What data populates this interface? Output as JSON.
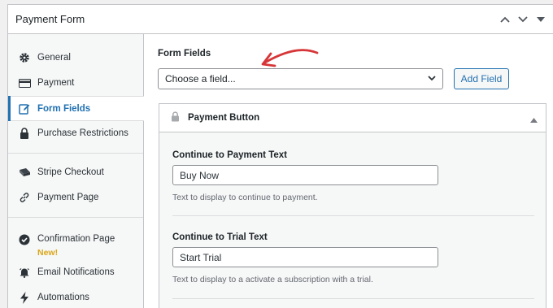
{
  "panel": {
    "title": "Payment Form"
  },
  "sidebar": {
    "tabs": [
      {
        "label": "General",
        "icon": "gear-icon"
      },
      {
        "label": "Payment",
        "icon": "credit-card-icon"
      },
      {
        "label": "Form Fields",
        "icon": "edit-icon"
      },
      {
        "label": "Purchase Restrictions",
        "icon": "lock-icon"
      },
      {
        "label": "Stripe Checkout",
        "icon": "stripe-icon"
      },
      {
        "label": "Payment Page",
        "icon": "link-icon"
      },
      {
        "label": "Confirmation Page",
        "badge": "New!",
        "icon": "check-circle-icon"
      },
      {
        "label": "Email Notifications",
        "icon": "bell-icon"
      },
      {
        "label": "Automations",
        "icon": "bolt-icon"
      }
    ]
  },
  "main": {
    "form_fields_label": "Form Fields",
    "select_value": "Choose a field...",
    "add_field_label": "Add Field",
    "field": {
      "title": "Payment Button",
      "continue_label": "Continue to Payment Text",
      "continue_value": "Buy Now",
      "continue_help": "Text to display to continue to payment.",
      "trial_label": "Continue to Trial Text",
      "trial_value": "Start Trial",
      "trial_help": "Text to display to a activate a subscription with a trial."
    }
  },
  "colors": {
    "accent": "#2271b1",
    "badge": "#dba617",
    "annotation_arrow": "#d63638"
  }
}
